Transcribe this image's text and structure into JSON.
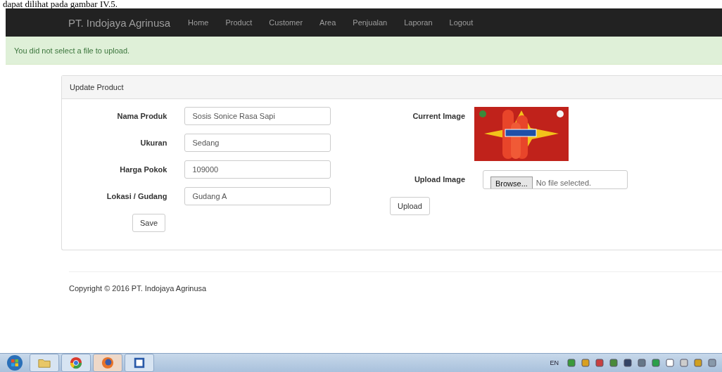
{
  "document_text": "dapat dilihat pada gambar IV.5.",
  "navbar": {
    "brand": "PT. Indojaya Agrinusa",
    "links": [
      {
        "label": "Home"
      },
      {
        "label": "Product"
      },
      {
        "label": "Customer"
      },
      {
        "label": "Area"
      },
      {
        "label": "Penjualan"
      },
      {
        "label": "Laporan"
      },
      {
        "label": "Logout"
      }
    ]
  },
  "alert": "You did not select a file to upload.",
  "panel": {
    "title": "Update Product",
    "fields": [
      {
        "label": "Nama Produk",
        "value": "Sosis Sonice Rasa Sapi"
      },
      {
        "label": "Ukuran",
        "value": "Sedang"
      },
      {
        "label": "Harga Pokok",
        "value": "109000"
      },
      {
        "label": "Lokasi / Gudang",
        "value": "Gudang A"
      }
    ],
    "save_button": "Save",
    "current_image_label": "Current Image",
    "upload_image_label": "Upload Image",
    "browse_button": "Browse...",
    "file_status": "No file selected.",
    "upload_button": "Upload"
  },
  "footer": "Copyright © 2016 PT. Indojaya Agrinusa",
  "taskbar": {
    "language": "EN"
  }
}
